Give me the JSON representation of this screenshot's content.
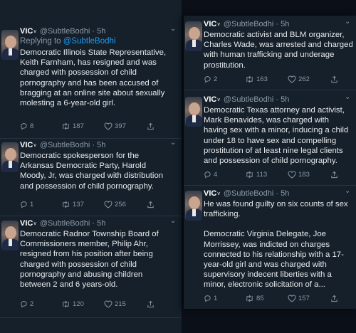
{
  "tweets_left": [
    {
      "name": "VIC",
      "verified": "v",
      "meta": "@SubtleBodhi · 5h",
      "reply_prefix": "Replying to",
      "reply_handle": "@SubtleBodhi",
      "lines": [
        "Democratic Illinois State Representative,",
        "Keith Farnham, has resigned and was",
        "charged with possession of child",
        "pornography and has been accused of",
        "bragging at an online site about sexually",
        "molesting a 6-year-old girl."
      ],
      "replies": "8",
      "retweets": "187",
      "likes": "397"
    },
    {
      "name": "VIC",
      "verified": "v",
      "meta": "@SubtleBodhi · 5h",
      "lines": [
        "Democratic spokesperson for the",
        "Arkansas Democratic Party, Harold",
        "Moody, Jr, was charged with distribution",
        "and possession of child pornography."
      ],
      "replies": "1",
      "retweets": "137",
      "likes": "256"
    },
    {
      "name": "VIC",
      "verified": "v",
      "meta": "@SubtleBodhi · 5h",
      "lines": [
        "Democratic Radnor Township Board of",
        "Commissioners member, Philip Ahr,",
        "resigned from his position after being",
        "charged with possession of child",
        "pornography and abusing children",
        "between 2 and 6 years-old."
      ],
      "replies": "2",
      "retweets": "120",
      "likes": "215"
    }
  ],
  "tweets_right": [
    {
      "name": "VIC",
      "verified": "v",
      "meta": "@SubtleBodhi · 5h",
      "lines": [
        "Democratic activist and BLM organizer,",
        "Charles Wade, was arrested and charged",
        "with human trafficking and underage",
        "prostitution."
      ],
      "replies": "2",
      "retweets": "163",
      "likes": "262"
    },
    {
      "name": "VIC",
      "verified": "v",
      "meta": "@SubtleBodhi · 5h",
      "lines": [
        "Democratic Texas attorney and activist,",
        "Mark Benavides, was charged with",
        "having sex with a minor, inducing a child",
        "under 18 to have sex and compelling",
        "prostitution of at least nine legal clients",
        "and possession of child pornography."
      ],
      "replies": "4",
      "retweets": "113",
      "likes": "183"
    },
    {
      "name": "VIC",
      "verified": "v",
      "meta": "@SubtleBodhi · 5h",
      "lines": [
        "He was found guilty on six counts of sex",
        "trafficking.",
        "",
        "Democratic Virginia Delegate, Joe",
        "Morrissey, was indicted on charges",
        "connected to his relationship with a 17-",
        "year-old girl and was charged with",
        "supervisory indecent liberties with a",
        "minor, electronic solicitation of a..."
      ],
      "replies": "1",
      "retweets": "85",
      "likes": "157"
    }
  ],
  "icons": {
    "reply": "reply-icon",
    "retweet": "retweet-icon",
    "like": "like-icon",
    "share": "share-icon",
    "more": "chevron-down-icon"
  },
  "colors": {
    "background": "#15202b",
    "text": "#e7e9ea",
    "muted": "#8b98a5",
    "link": "#1d9bf0"
  }
}
